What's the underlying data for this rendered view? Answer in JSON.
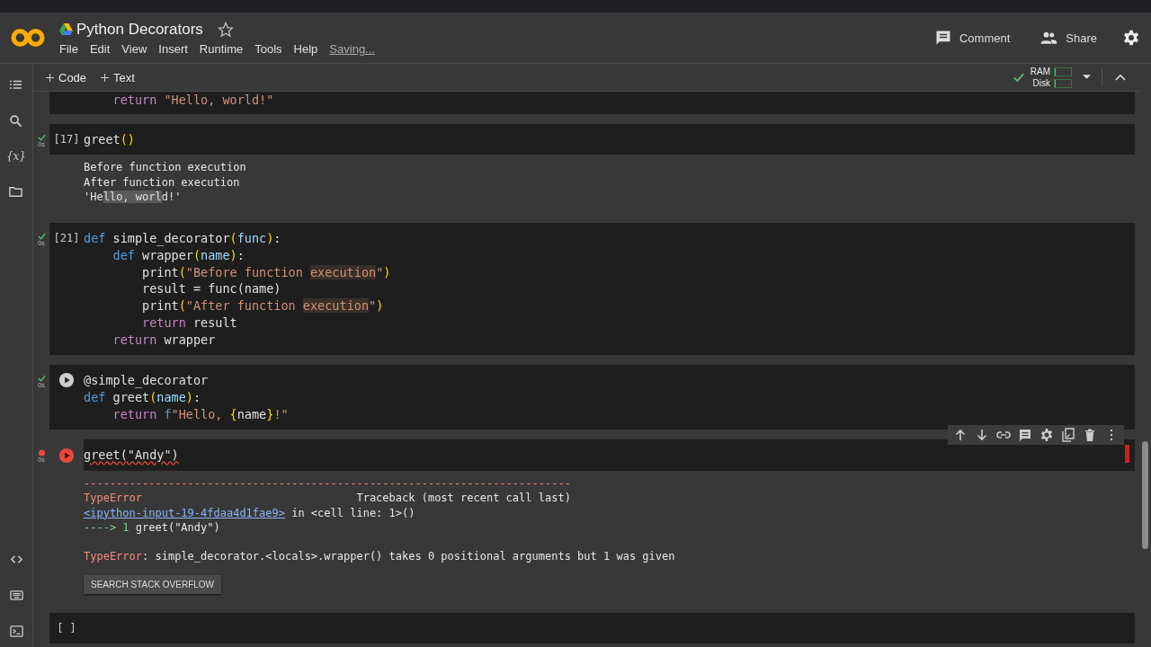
{
  "header": {
    "title": "Python Decorators",
    "starred": false,
    "menu": [
      "File",
      "Edit",
      "View",
      "Insert",
      "Runtime",
      "Tools",
      "Help"
    ],
    "save_status": "Saving...",
    "actions": [
      {
        "kind": "comment",
        "label": "Comment"
      },
      {
        "kind": "share",
        "label": "Share"
      },
      {
        "kind": "settings"
      }
    ]
  },
  "toolbar": {
    "buttons": [
      {
        "label": "Code"
      },
      {
        "label": "Text"
      }
    ],
    "resources": [
      {
        "label": "RAM",
        "level": 0.05
      },
      {
        "label": "Disk",
        "level": 0.05
      }
    ]
  },
  "sidebar": {
    "top": [
      {
        "kind": "toc"
      },
      {
        "kind": "search"
      },
      {
        "kind": "variables",
        "label": "{x}"
      },
      {
        "kind": "files"
      }
    ],
    "bottom": [
      {
        "kind": "code"
      },
      {
        "kind": "keyboard"
      },
      {
        "kind": "terminal"
      }
    ]
  },
  "cells": [
    {
      "code": [
        [
          {
            "kind": "ctl",
            "t": "    return "
          },
          {
            "kind": "str",
            "t": "\"Hello, world!\""
          }
        ]
      ]
    },
    {
      "ran": true,
      "error": false,
      "time": "0s",
      "prompt": "[17]",
      "code": [
        [
          {
            "kind": "plain",
            "t": "greet"
          },
          {
            "kind": "paren",
            "t": "()"
          }
        ]
      ],
      "output": [
        [
          [
            {
              "kind": "out",
              "t": "Before function execution"
            }
          ],
          [
            {
              "kind": "out",
              "t": "After function execution"
            }
          ],
          [
            {
              "kind": "out",
              "t": "'He"
            },
            {
              "kind": "hl",
              "t": "llo, worl"
            },
            {
              "kind": "out",
              "t": "d!'"
            }
          ]
        ]
      ]
    },
    {
      "ran": true,
      "error": false,
      "time": "0s",
      "prompt": "[21]",
      "code": [
        [
          {
            "kind": "kw",
            "t": "def "
          },
          {
            "kind": "plain",
            "t": "simple_decorator"
          },
          {
            "kind": "paren",
            "t": "("
          },
          {
            "kind": "param",
            "t": "func"
          },
          {
            "kind": "paren",
            "t": ")"
          },
          {
            "kind": "plain",
            "t": ":"
          }
        ],
        [
          {
            "kind": "kw",
            "t": "    def "
          },
          {
            "kind": "plain",
            "t": "wrapper"
          },
          {
            "kind": "paren",
            "t": "("
          },
          {
            "kind": "param",
            "t": "name"
          },
          {
            "kind": "paren",
            "t": ")"
          },
          {
            "kind": "plain",
            "t": ":"
          }
        ],
        [
          {
            "kind": "plain",
            "t": "        print"
          },
          {
            "kind": "paren",
            "t": "("
          },
          {
            "kind": "str",
            "t": "\"Before function "
          },
          {
            "kind": "strhl",
            "t": "execution"
          },
          {
            "kind": "str",
            "t": "\""
          },
          {
            "kind": "paren",
            "t": ")"
          }
        ],
        [
          {
            "kind": "plain",
            "t": "        result = func(name)"
          }
        ],
        [
          {
            "kind": "plain",
            "t": "        print"
          },
          {
            "kind": "paren",
            "t": "("
          },
          {
            "kind": "str",
            "t": "\"After function "
          },
          {
            "kind": "strhl",
            "t": "execution"
          },
          {
            "kind": "str",
            "t": "\""
          },
          {
            "kind": "paren",
            "t": ")"
          }
        ],
        [
          {
            "kind": "ctl",
            "t": "        return "
          },
          {
            "kind": "plain",
            "t": "result"
          }
        ],
        [
          {
            "kind": "ctl",
            "t": "    return "
          },
          {
            "kind": "plain",
            "t": "wrapper"
          }
        ]
      ]
    },
    {
      "ran": true,
      "error": false,
      "time": "0s",
      "run_button": true,
      "code": [
        [
          {
            "kind": "plain",
            "t": "@simple_decorator"
          }
        ],
        [
          {
            "kind": "kw",
            "t": "def "
          },
          {
            "kind": "plain",
            "t": "greet"
          },
          {
            "kind": "paren",
            "t": "("
          },
          {
            "kind": "param",
            "t": "name"
          },
          {
            "kind": "paren",
            "t": ")"
          },
          {
            "kind": "plain",
            "t": ":"
          }
        ],
        [
          {
            "kind": "ctl",
            "t": "    return "
          },
          {
            "kind": "kw",
            "t": "f"
          },
          {
            "kind": "str",
            "t": "\"Hello, "
          },
          {
            "kind": "paren",
            "t": "{"
          },
          {
            "kind": "plain",
            "t": "name"
          },
          {
            "kind": "paren",
            "t": "}"
          },
          {
            "kind": "str",
            "t": "!\""
          }
        ]
      ]
    },
    {
      "ran": true,
      "error": true,
      "time": "0s",
      "run_button": true,
      "active": true,
      "code": [
        [
          {
            "kind": "squig",
            "t": "greet(\"Andy\")"
          }
        ]
      ],
      "output": [
        [
          [
            {
              "kind": "err",
              "t": "---------------------------------------------------------------------------"
            }
          ],
          [
            {
              "kind": "err",
              "t": "TypeError"
            },
            {
              "kind": "out",
              "t": "                                 Traceback (most recent call last)"
            }
          ],
          [
            {
              "kind": "link",
              "t": "<ipython-input-19-4fdaa4d1fae9>"
            },
            {
              "kind": "out",
              "t": " in <cell line: 1>()"
            }
          ],
          [
            {
              "kind": "arrow",
              "t": "----> 1 "
            },
            {
              "kind": "out",
              "t": "greet(\"Andy\")"
            }
          ]
        ],
        [
          [
            {
              "kind": "err",
              "t": "TypeError"
            },
            {
              "kind": "out",
              "t": ": simple_decorator.<locals>.wrapper() takes 0 positional arguments but 1 was given"
            }
          ]
        ]
      ],
      "action": "SEARCH STACK OVERFLOW"
    },
    {
      "prompt": "[ ]"
    }
  ]
}
